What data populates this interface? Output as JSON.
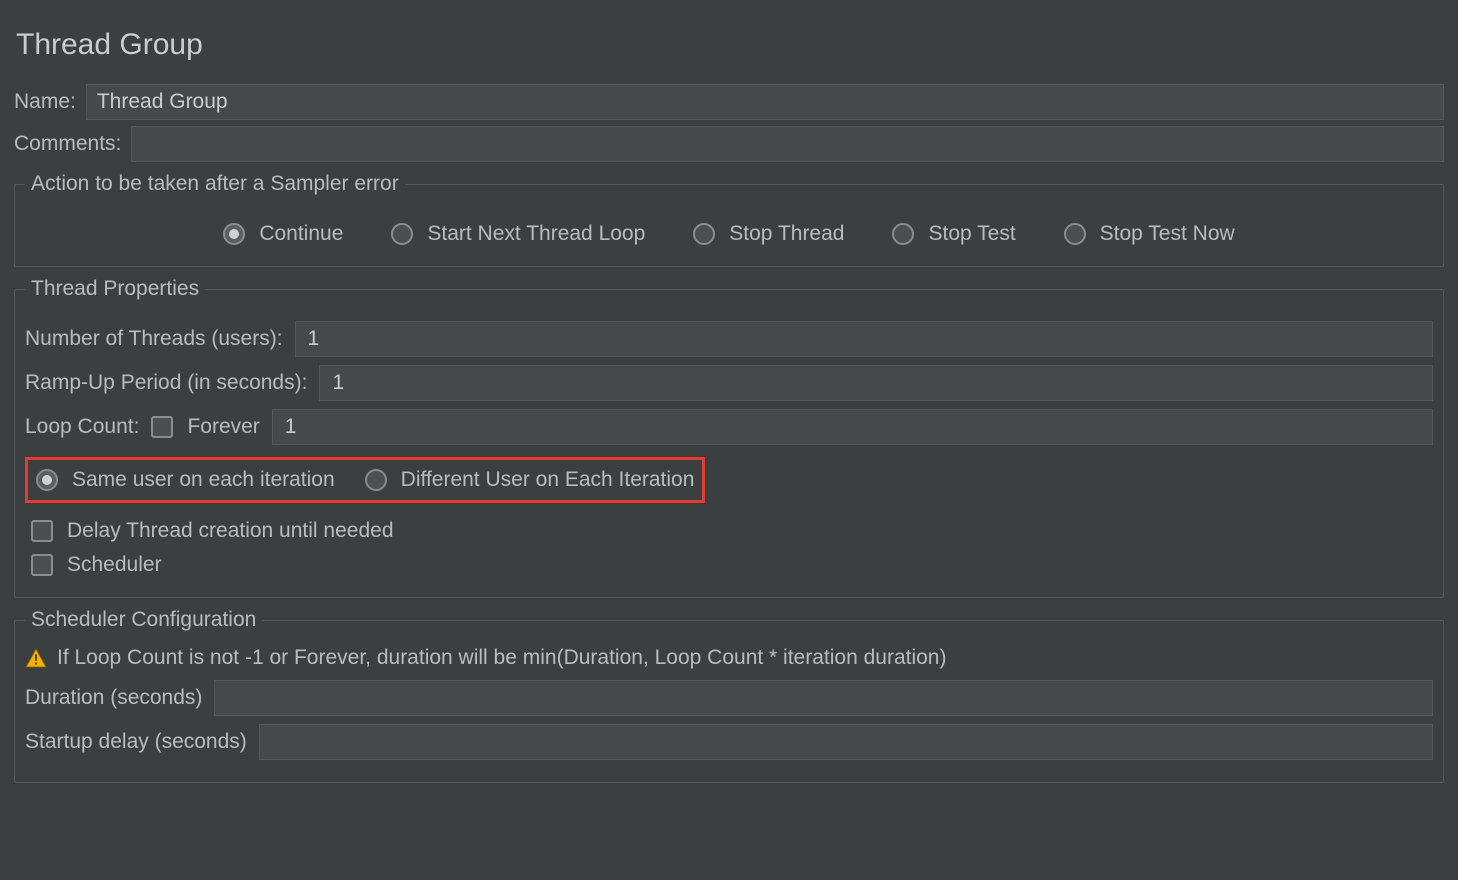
{
  "title": "Thread Group",
  "name_row": {
    "label": "Name:",
    "value": "Thread Group"
  },
  "comments_row": {
    "label": "Comments:",
    "value": ""
  },
  "error_group": {
    "legend": "Action to be taken after a Sampler error",
    "options": {
      "continue": "Continue",
      "start_next": "Start Next Thread Loop",
      "stop_thread": "Stop Thread",
      "stop_test": "Stop Test",
      "stop_test_now": "Stop Test Now"
    }
  },
  "thread_props": {
    "legend": "Thread Properties",
    "num_threads_label": "Number of Threads (users):",
    "num_threads_value": "1",
    "ramp_up_label": "Ramp-Up Period (in seconds):",
    "ramp_up_value": "1",
    "loop_count_label": "Loop Count:",
    "forever_label": "Forever",
    "loop_count_value": "1",
    "same_user_label": "Same user on each iteration",
    "diff_user_label": "Different User on Each Iteration",
    "delay_creation_label": "Delay Thread creation until needed",
    "scheduler_label": "Scheduler"
  },
  "scheduler_group": {
    "legend": "Scheduler Configuration",
    "hint": "If Loop Count is not -1 or Forever, duration will be min(Duration, Loop Count * iteration duration)",
    "duration_label": "Duration (seconds)",
    "duration_value": "",
    "startup_delay_label": "Startup delay (seconds)",
    "startup_delay_value": ""
  }
}
